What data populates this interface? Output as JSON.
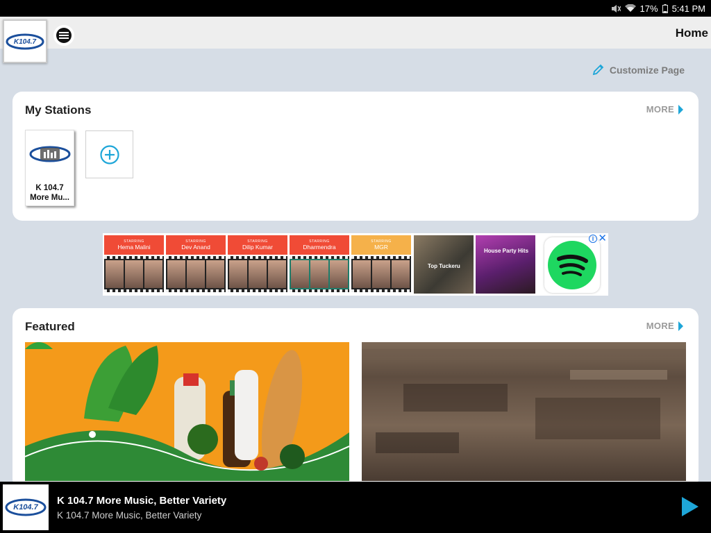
{
  "status_bar": {
    "battery": "17%",
    "time": "5:41 PM"
  },
  "app_bar": {
    "page_title": "Home"
  },
  "customize": {
    "label": "Customize Page"
  },
  "my_stations": {
    "title": "My Stations",
    "more_label": "MORE",
    "stations": [
      {
        "name": "K 104.7\nMore Mu..."
      }
    ]
  },
  "ad": {
    "tiles": [
      {
        "starring": "STARRING",
        "name": "Hema Malini",
        "color": "#f04b36"
      },
      {
        "starring": "STARRING",
        "name": "Dev Anand",
        "color": "#f04b36"
      },
      {
        "starring": "STARRING",
        "name": "Dilip Kumar",
        "color": "#f04b36"
      },
      {
        "starring": "STARRING",
        "name": "Dharmendra",
        "color": "#f04b36"
      },
      {
        "starring": "STARRING",
        "name": "MGR",
        "color": "#f5b14a"
      }
    ],
    "photo1_label": "Top Tuckeru",
    "photo2_label": "House Party Hits",
    "info": "i",
    "close": "✕"
  },
  "featured": {
    "title": "Featured",
    "more_label": "MORE"
  },
  "player": {
    "title": "K 104.7 More Music, Better Variety",
    "subtitle": "K 104.7 More Music, Better Variety"
  },
  "logo_text": "K104.7",
  "colors": {
    "accent": "#1ea6d8",
    "spotify_green": "#1ed760"
  },
  "icons": [
    "mute-icon",
    "wifi-icon",
    "battery-icon",
    "menu-icon",
    "pencil-icon",
    "add-circle-icon",
    "play-icon",
    "spotify-icon"
  ]
}
